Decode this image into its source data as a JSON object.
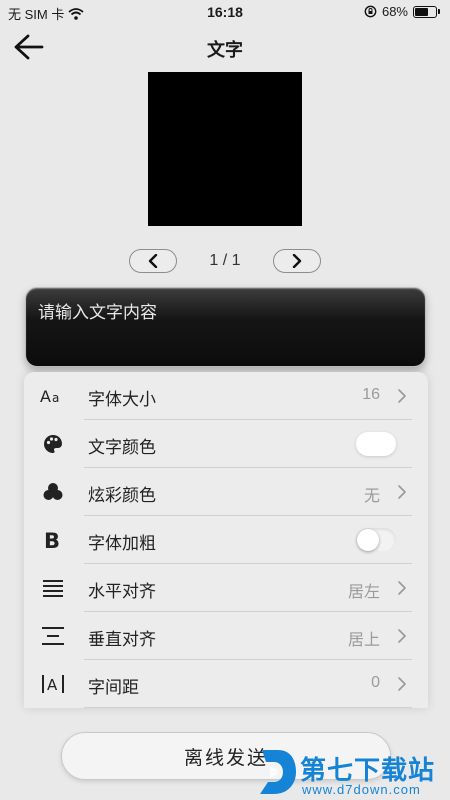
{
  "status_bar": {
    "carrier": "无 SIM 卡",
    "time": "16:18",
    "battery": "68%",
    "battery_level": 0.68
  },
  "header": {
    "title": "文字",
    "back_icon": "arrow-left-icon"
  },
  "pager": {
    "label": "1 / 1",
    "prev_icon": "chevron-left-icon",
    "next_icon": "chevron-right-icon"
  },
  "text_input": {
    "placeholder": "请输入文字内容"
  },
  "settings": {
    "font_size": {
      "label": "字体大小",
      "value": "16",
      "icon": "font-size-icon"
    },
    "text_color": {
      "label": "文字颜色",
      "icon": "palette-icon",
      "toggle_on": true
    },
    "gradient_color": {
      "label": "炫彩颜色",
      "value": "无",
      "icon": "color-blobs-icon"
    },
    "bold": {
      "label": "字体加粗",
      "icon": "bold-icon",
      "toggle_on": false
    },
    "horizontal_align": {
      "label": "水平对齐",
      "value": "居左",
      "icon": "align-horizontal-icon"
    },
    "vertical_align": {
      "label": "垂直对齐",
      "value": "居上",
      "icon": "align-vertical-icon"
    },
    "letter_spacing": {
      "label": "字间距",
      "value": "0",
      "icon": "letter-spacing-icon"
    }
  },
  "footer": {
    "send_label": "离线发送"
  },
  "watermark": {
    "brand": "第七下载站",
    "url": "www.d7down.com"
  },
  "colors": {
    "background": "#e9e9e9",
    "preview": "#000000",
    "watermark_blue": "#1684d6"
  }
}
